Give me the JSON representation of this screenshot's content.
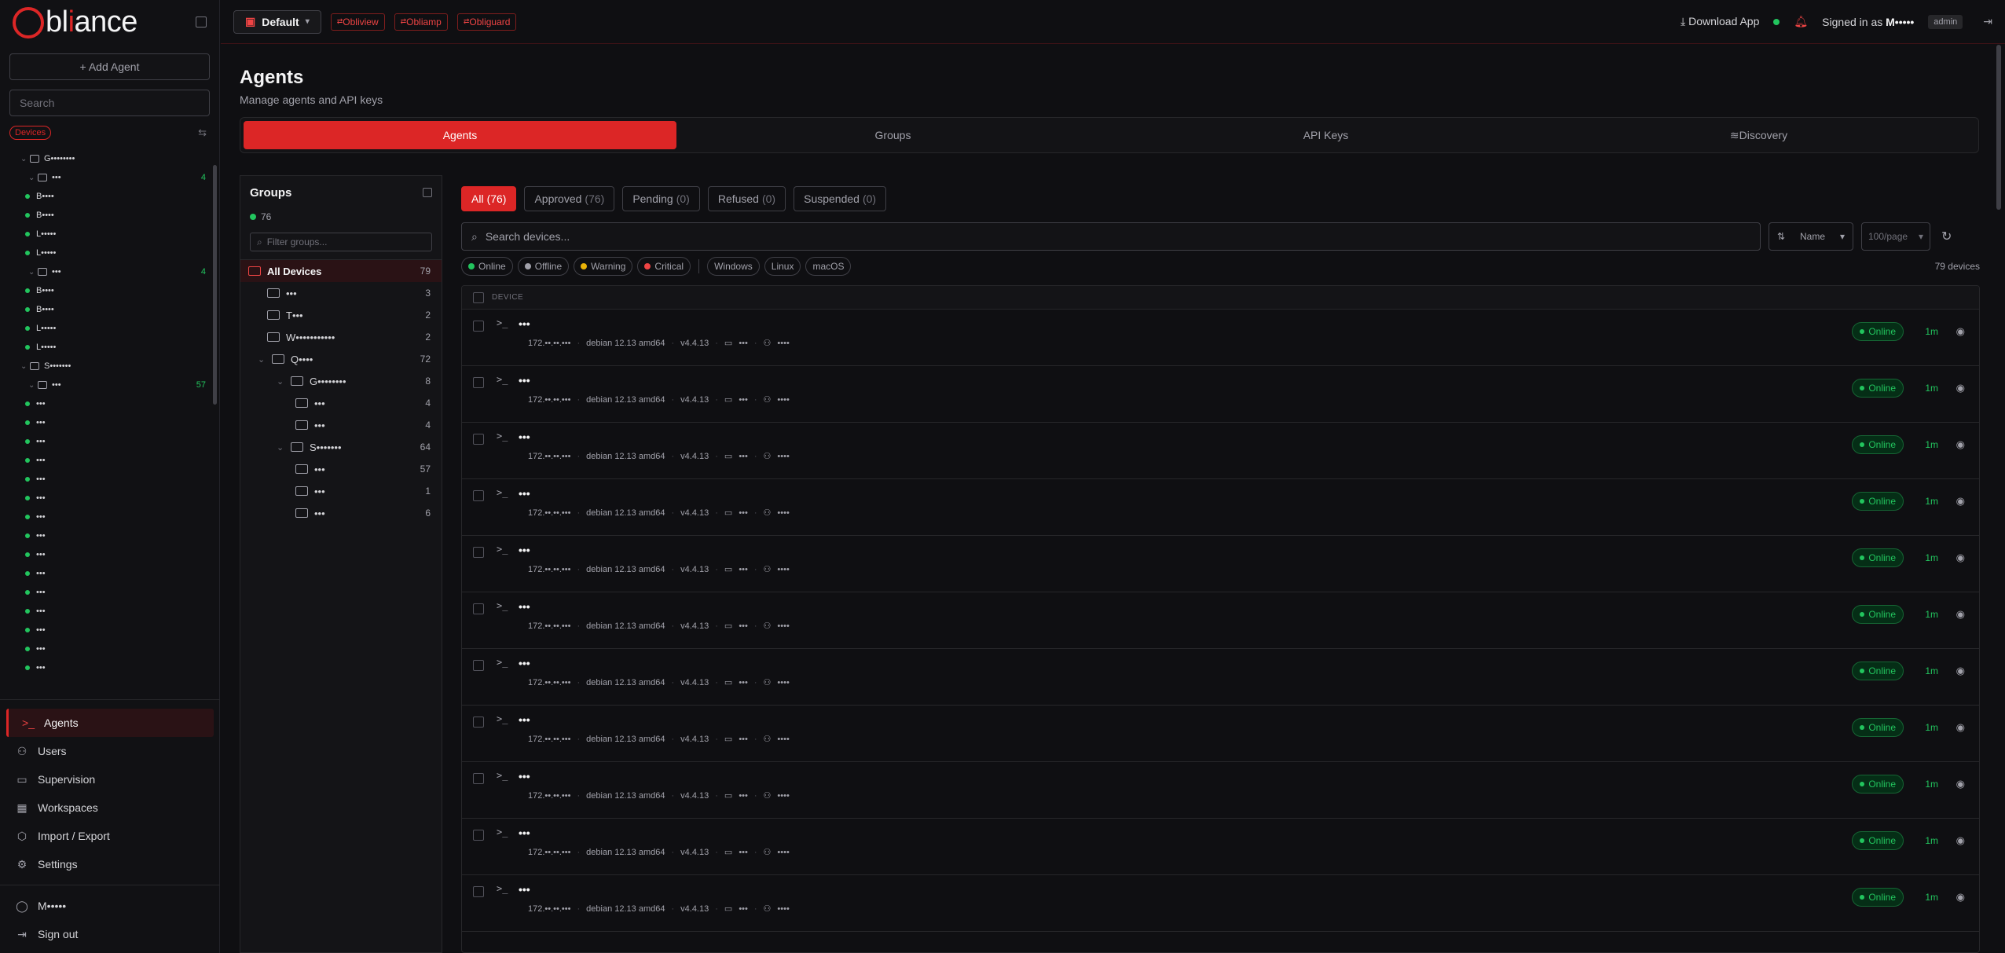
{
  "brand": {
    "logo_text_1": "bl",
    "logo_text_2": "i",
    "logo_text_3": "ance"
  },
  "sidebar": {
    "add_agent_label": "+ Add Agent",
    "search_placeholder": "Search",
    "devices_chip": "Devices",
    "tree": [
      {
        "kind": "group",
        "indent": 1,
        "label": "G••••••••",
        "count": ""
      },
      {
        "kind": "server",
        "indent": 2,
        "label": "•••",
        "count": "4"
      },
      {
        "kind": "device",
        "indent": 2,
        "label": "B••••",
        "count": ""
      },
      {
        "kind": "device",
        "indent": 2,
        "label": "B••••",
        "count": ""
      },
      {
        "kind": "device",
        "indent": 2,
        "label": "L•••••",
        "count": ""
      },
      {
        "kind": "device",
        "indent": 2,
        "label": "L•••••",
        "count": ""
      },
      {
        "kind": "server",
        "indent": 2,
        "label": "•••",
        "count": "4"
      },
      {
        "kind": "device",
        "indent": 2,
        "label": "B••••",
        "count": ""
      },
      {
        "kind": "device",
        "indent": 2,
        "label": "B••••",
        "count": ""
      },
      {
        "kind": "device",
        "indent": 2,
        "label": "L•••••",
        "count": ""
      },
      {
        "kind": "device",
        "indent": 2,
        "label": "L•••••",
        "count": ""
      },
      {
        "kind": "group",
        "indent": 1,
        "label": "S•••••••",
        "count": ""
      },
      {
        "kind": "server",
        "indent": 2,
        "label": "•••",
        "count": "57"
      },
      {
        "kind": "device",
        "indent": 2,
        "label": "•••",
        "count": ""
      },
      {
        "kind": "device",
        "indent": 2,
        "label": "•••",
        "count": ""
      },
      {
        "kind": "device",
        "indent": 2,
        "label": "•••",
        "count": ""
      },
      {
        "kind": "device",
        "indent": 2,
        "label": "•••",
        "count": ""
      },
      {
        "kind": "device",
        "indent": 2,
        "label": "•••",
        "count": ""
      },
      {
        "kind": "device",
        "indent": 2,
        "label": "•••",
        "count": ""
      },
      {
        "kind": "device",
        "indent": 2,
        "label": "•••",
        "count": ""
      },
      {
        "kind": "device",
        "indent": 2,
        "label": "•••",
        "count": ""
      },
      {
        "kind": "device",
        "indent": 2,
        "label": "•••",
        "count": ""
      },
      {
        "kind": "device",
        "indent": 2,
        "label": "•••",
        "count": ""
      },
      {
        "kind": "device",
        "indent": 2,
        "label": "•••",
        "count": ""
      },
      {
        "kind": "device",
        "indent": 2,
        "label": "•••",
        "count": ""
      },
      {
        "kind": "device",
        "indent": 2,
        "label": "•••",
        "count": ""
      },
      {
        "kind": "device",
        "indent": 2,
        "label": "•••",
        "count": ""
      },
      {
        "kind": "device",
        "indent": 2,
        "label": "•••",
        "count": ""
      }
    ],
    "nav": [
      {
        "label": "Agents",
        "icon": "terminal-icon",
        "active": true
      },
      {
        "label": "Users",
        "icon": "users-icon",
        "active": false
      },
      {
        "label": "Supervision",
        "icon": "monitor-icon",
        "active": false
      },
      {
        "label": "Workspaces",
        "icon": "building-icon",
        "active": false
      },
      {
        "label": "Import / Export",
        "icon": "package-icon",
        "active": false
      },
      {
        "label": "Settings",
        "icon": "gear-icon",
        "active": false
      }
    ],
    "user_label": "M•••••",
    "signout_label": "Sign out"
  },
  "topbar": {
    "workspace_label": "Default",
    "apps": [
      "Obliview",
      "Obliamp",
      "Obliguard"
    ],
    "download_label": "Download App",
    "signed_in_prefix": "Signed in as",
    "signed_in_user": "M•••••",
    "role": "admin"
  },
  "page": {
    "title": "Agents",
    "subtitle": "Manage agents and API keys",
    "tabs": [
      {
        "label": "Agents",
        "active": true
      },
      {
        "label": "Groups",
        "active": false
      },
      {
        "label": "API Keys",
        "active": false
      },
      {
        "label": "Discovery",
        "active": false
      }
    ]
  },
  "groups": {
    "title": "Groups",
    "online_count": "76",
    "filter_placeholder": "Filter groups...",
    "items": [
      {
        "label": "All Devices",
        "count": "79",
        "level": 0,
        "chev": "",
        "active": true
      },
      {
        "label": "•••",
        "count": "3",
        "level": 1,
        "chev": "",
        "active": false
      },
      {
        "label": "T•••",
        "count": "2",
        "level": 1,
        "chev": "",
        "active": false
      },
      {
        "label": "W•••••••••••",
        "count": "2",
        "level": 1,
        "chev": "",
        "active": false
      },
      {
        "label": "Q••••",
        "count": "72",
        "level": 0.5,
        "chev": "v",
        "active": false
      },
      {
        "label": "G••••••••",
        "count": "8",
        "level": 1.5,
        "chev": "v",
        "active": false
      },
      {
        "label": "•••",
        "count": "4",
        "level": 2.5,
        "chev": "",
        "active": false
      },
      {
        "label": "•••",
        "count": "4",
        "level": 2.5,
        "chev": "",
        "active": false
      },
      {
        "label": "S•••••••",
        "count": "64",
        "level": 1.5,
        "chev": "v",
        "active": false
      },
      {
        "label": "•••",
        "count": "57",
        "level": 2.5,
        "chev": "",
        "active": false
      },
      {
        "label": "•••",
        "count": "1",
        "level": 2.5,
        "chev": "",
        "active": false
      },
      {
        "label": "•••",
        "count": "6",
        "level": 2.5,
        "chev": "",
        "active": false
      }
    ]
  },
  "devices": {
    "filter_tabs": [
      {
        "label": "All",
        "count": "(76)",
        "active": true
      },
      {
        "label": "Approved",
        "count": "(76)",
        "active": false
      },
      {
        "label": "Pending",
        "count": "(0)",
        "active": false
      },
      {
        "label": "Refused",
        "count": "(0)",
        "active": false
      },
      {
        "label": "Suspended",
        "count": "(0)",
        "active": false
      }
    ],
    "search_placeholder": "Search devices...",
    "sort_label": "Name",
    "per_page_label": "100/page",
    "status_chips": [
      {
        "label": "Online",
        "color": "#22c55e"
      },
      {
        "label": "Offline",
        "color": "#a1a1aa"
      },
      {
        "label": "Warning",
        "color": "#eab308"
      },
      {
        "label": "Critical",
        "color": "#ef4444"
      }
    ],
    "os_chips": [
      "Windows",
      "Linux",
      "macOS"
    ],
    "total_label": "79 devices",
    "column_header": "DEVICE",
    "rows": [
      {
        "name": "•••",
        "ip": "172.••.••.•••",
        "os": "debian 12.13 amd64",
        "version": "v4.4.13",
        "group": "•••",
        "user": "••••",
        "status": "Online",
        "last_seen": "1m"
      },
      {
        "name": "•••",
        "ip": "172.••.••.•••",
        "os": "debian 12.13 amd64",
        "version": "v4.4.13",
        "group": "•••",
        "user": "••••",
        "status": "Online",
        "last_seen": "1m"
      },
      {
        "name": "•••",
        "ip": "172.••.••.•••",
        "os": "debian 12.13 amd64",
        "version": "v4.4.13",
        "group": "•••",
        "user": "••••",
        "status": "Online",
        "last_seen": "1m"
      },
      {
        "name": "•••",
        "ip": "172.••.••.•••",
        "os": "debian 12.13 amd64",
        "version": "v4.4.13",
        "group": "•••",
        "user": "••••",
        "status": "Online",
        "last_seen": "1m"
      },
      {
        "name": "•••",
        "ip": "172.••.••.•••",
        "os": "debian 12.13 amd64",
        "version": "v4.4.13",
        "group": "•••",
        "user": "••••",
        "status": "Online",
        "last_seen": "1m"
      },
      {
        "name": "•••",
        "ip": "172.••.••.•••",
        "os": "debian 12.13 amd64",
        "version": "v4.4.13",
        "group": "•••",
        "user": "••••",
        "status": "Online",
        "last_seen": "1m"
      },
      {
        "name": "•••",
        "ip": "172.••.••.•••",
        "os": "debian 12.13 amd64",
        "version": "v4.4.13",
        "group": "•••",
        "user": "••••",
        "status": "Online",
        "last_seen": "1m"
      },
      {
        "name": "•••",
        "ip": "172.••.••.•••",
        "os": "debian 12.13 amd64",
        "version": "v4.4.13",
        "group": "•••",
        "user": "••••",
        "status": "Online",
        "last_seen": "1m"
      },
      {
        "name": "•••",
        "ip": "172.••.••.•••",
        "os": "debian 12.13 amd64",
        "version": "v4.4.13",
        "group": "•••",
        "user": "••••",
        "status": "Online",
        "last_seen": "1m"
      },
      {
        "name": "•••",
        "ip": "172.••.••.•••",
        "os": "debian 12.13 amd64",
        "version": "v4.4.13",
        "group": "•••",
        "user": "••••",
        "status": "Online",
        "last_seen": "1m"
      },
      {
        "name": "•••",
        "ip": "172.••.••.•••",
        "os": "debian 12.13 amd64",
        "version": "v4.4.13",
        "group": "•••",
        "user": "••••",
        "status": "Online",
        "last_seen": "1m"
      }
    ]
  },
  "colors": {
    "accent": "#dc2626",
    "online": "#22c55e",
    "background": "#0f0f12"
  }
}
